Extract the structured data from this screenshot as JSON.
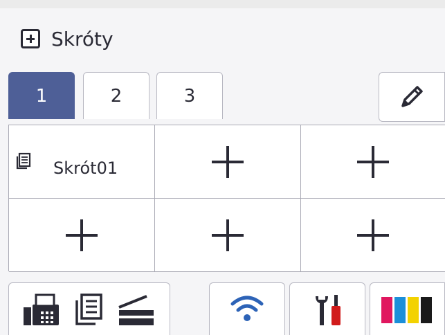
{
  "header": {
    "title": "Skróty",
    "add_icon": "plus-square-icon"
  },
  "tabs": [
    {
      "label": "1",
      "active": true
    },
    {
      "label": "2",
      "active": false
    },
    {
      "label": "3",
      "active": false
    }
  ],
  "edit_icon": "pencil-icon",
  "grid": {
    "cells": [
      {
        "type": "shortcut",
        "label": "Skrót01",
        "icon": "document-copy-icon"
      },
      {
        "type": "add",
        "icon": "plus-icon"
      },
      {
        "type": "add",
        "icon": "plus-icon"
      },
      {
        "type": "add",
        "icon": "plus-icon"
      },
      {
        "type": "add",
        "icon": "plus-icon"
      },
      {
        "type": "add",
        "icon": "plus-icon"
      }
    ]
  },
  "bottom_bar": {
    "mode_icons": [
      "fax-icon",
      "copy-icon",
      "scan-icon"
    ],
    "wifi_icon": "wifi-icon",
    "settings_icon": "tools-icon",
    "ink_icon": "ink-cartridges-icon",
    "ink_colors": [
      "#e0175f",
      "#1b8fd9",
      "#f3d200",
      "#1a1a1a"
    ]
  },
  "colors": {
    "active_tab": "#4e5f97",
    "wifi": "#2d63b7",
    "tool_red": "#d11b1b"
  }
}
